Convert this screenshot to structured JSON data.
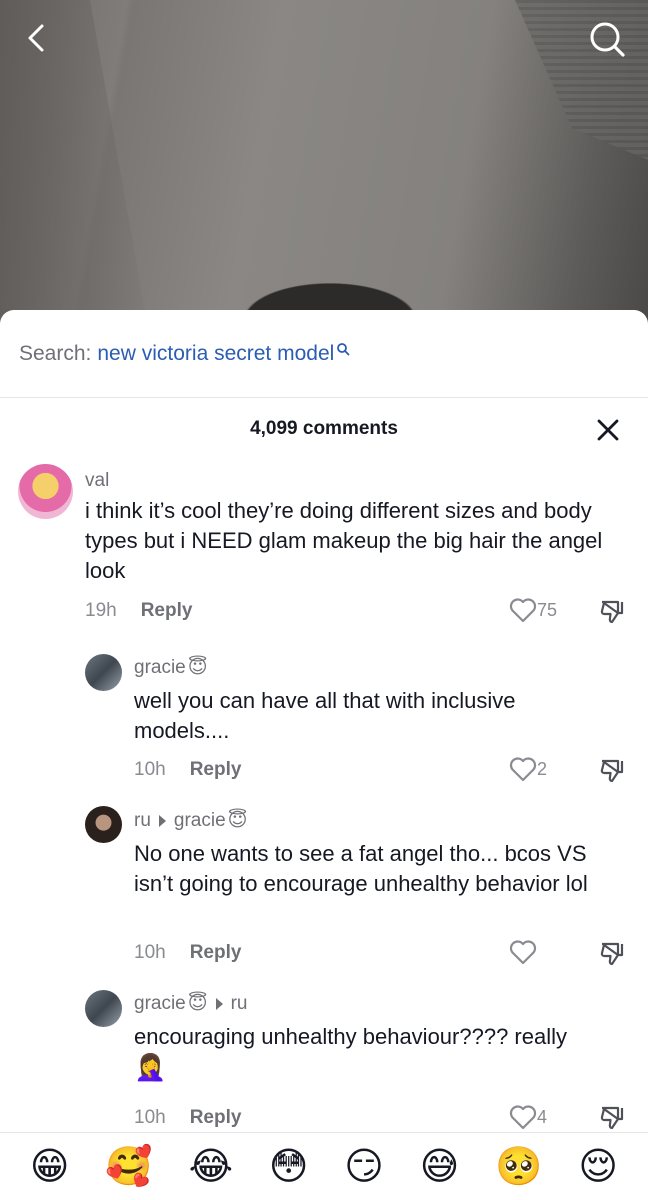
{
  "search": {
    "prefix": "Search:",
    "term": "new victoria secret model"
  },
  "comments_header": {
    "count_label": "4,099 comments"
  },
  "comments": [
    {
      "username": "val",
      "text": "i think it’s cool they’re doing different sizes and body types but i NEED glam makeup the big hair the angel look",
      "time": "19h",
      "reply_label": "Reply",
      "likes": "75"
    },
    {
      "username": "gracie",
      "username_emoji": "😇",
      "text": "well you can have all that with inclusive models....",
      "time": "10h",
      "reply_label": "Reply",
      "likes": "2"
    },
    {
      "username": "ru",
      "reply_to": "gracie",
      "reply_to_emoji": "😇",
      "text": "No one wants to see a fat angel tho... bcos VS isn’t going to encourage unhealthy behavior lol",
      "time": "10h",
      "reply_label": "Reply",
      "likes": ""
    },
    {
      "username": "gracie",
      "username_emoji": "😇",
      "reply_to": "ru",
      "text": "encouraging unhealthy behaviour???? really",
      "text_emoji": "🤦‍♀️",
      "time": "10h",
      "reply_label": "Reply",
      "likes": "4"
    }
  ],
  "emoji_bar": [
    "😁",
    "🥰",
    "😂",
    "😳",
    "😏",
    "😅",
    "🥺",
    "😌"
  ],
  "icons": {
    "back": "chevron-left-icon",
    "search": "search-icon",
    "close": "close-icon",
    "like": "heart-outline-icon",
    "dislike": "thumbs-down-icon"
  },
  "colors": {
    "search_term": "#2b5db4",
    "text": "#161823",
    "muted": "#8a8b91"
  }
}
